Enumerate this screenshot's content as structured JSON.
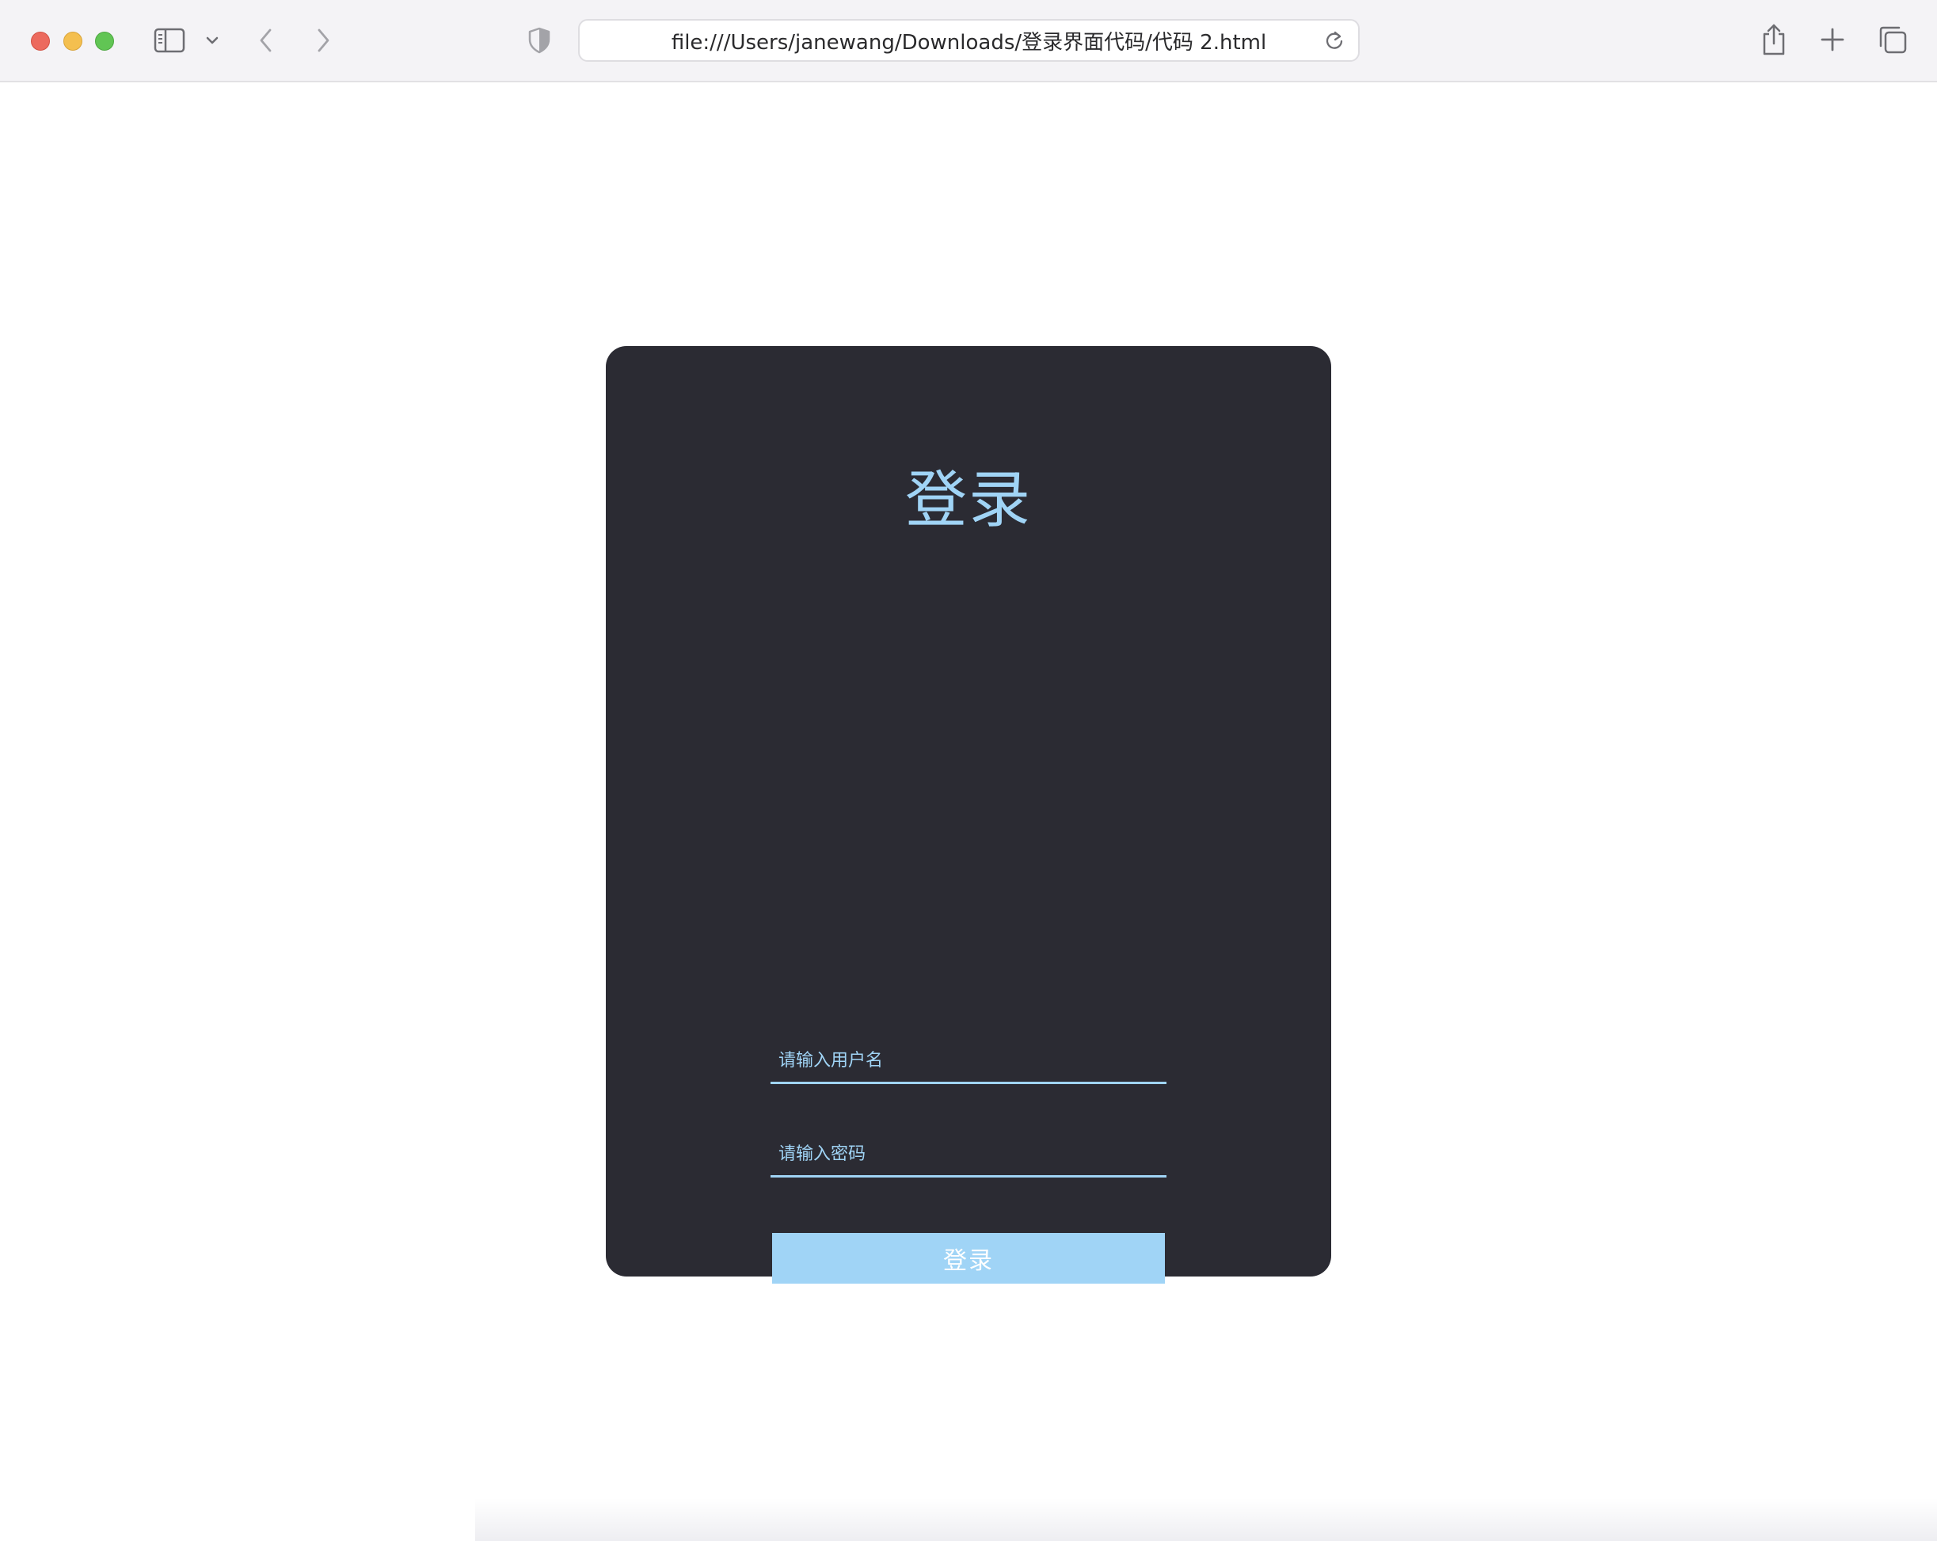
{
  "browser": {
    "url": "file:///Users/janewang/Downloads/登录界面代码/代码 2.html"
  },
  "login": {
    "title": "登录",
    "username_placeholder": "请输入用户名",
    "password_placeholder": "请输入密码",
    "submit_label": "登录"
  },
  "colors": {
    "card_background": "#2b2b33",
    "accent": "#a0d4f6",
    "button_text": "#ffffff"
  },
  "icons": {
    "sidebar_toggle": "sidebar-icon",
    "back": "chevron-left-icon",
    "forward": "chevron-right-icon",
    "privacy": "shield-icon",
    "reload": "reload-icon",
    "share": "share-icon",
    "new_tab": "plus-icon",
    "tab_overview": "tabs-icon"
  }
}
